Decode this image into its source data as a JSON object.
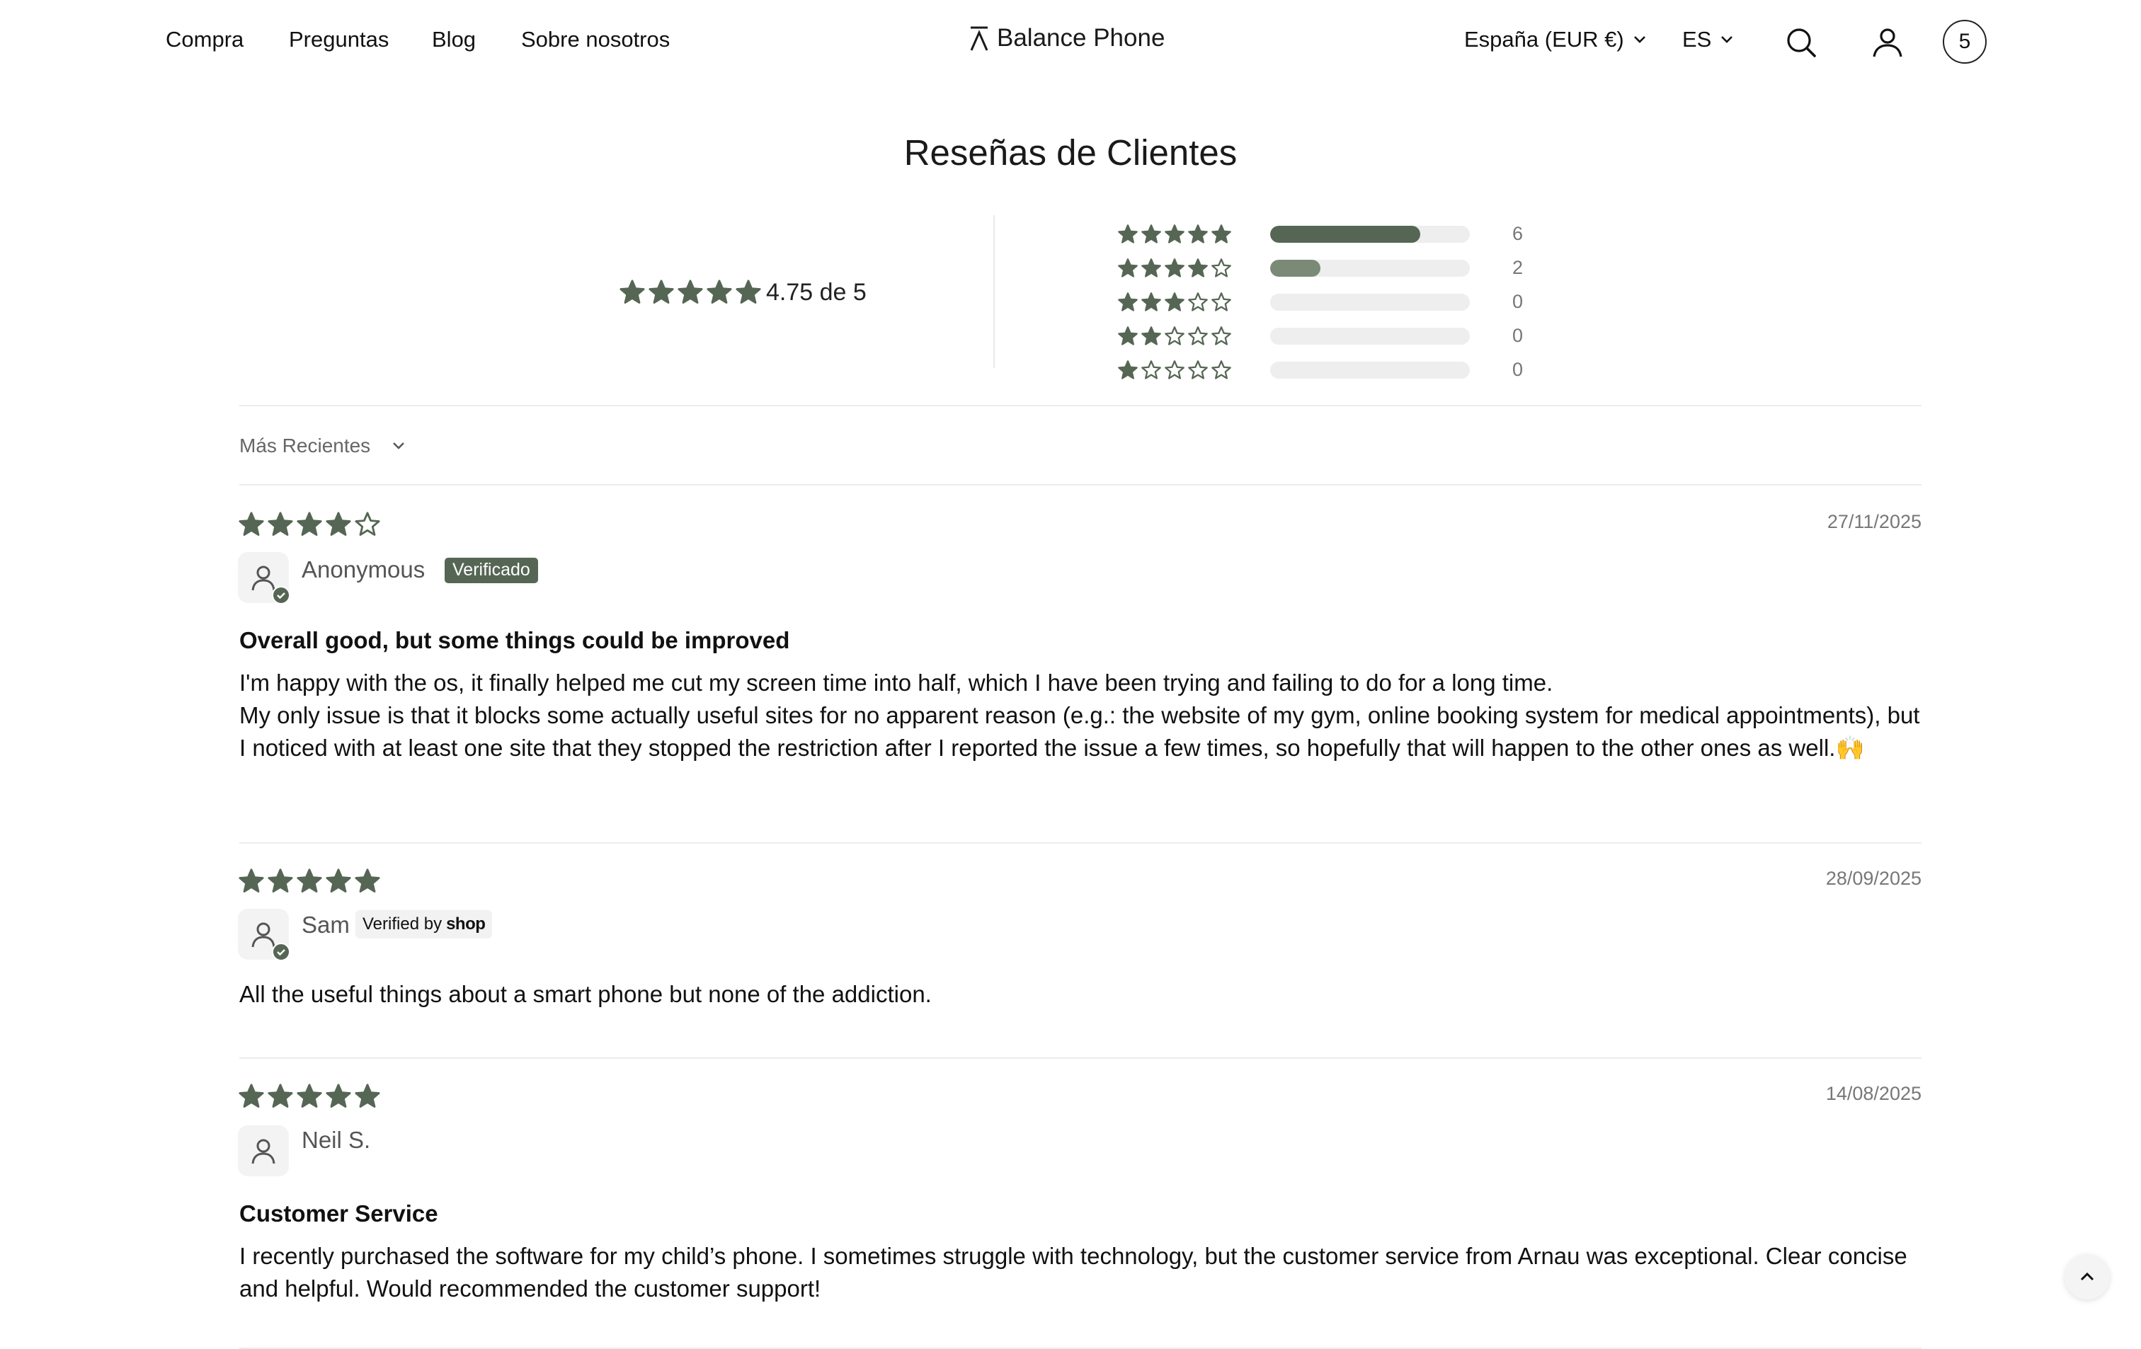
{
  "nav": {
    "links": [
      "Compra",
      "Preguntas",
      "Blog",
      "Sobre nosotros"
    ],
    "logo_text": "Balance Phone",
    "country_selector": "España (EUR €)",
    "language_selector": "ES",
    "cart_count": "5"
  },
  "reviews_summary": {
    "title": "Reseñas de Clientes",
    "average_rating": 4.75,
    "average_text": "4.75 de 5",
    "histogram": [
      {
        "stars": 5,
        "count": "6",
        "fraction": 0.75
      },
      {
        "stars": 4,
        "count": "2",
        "fraction": 0.25
      },
      {
        "stars": 3,
        "count": "0",
        "fraction": 0
      },
      {
        "stars": 2,
        "count": "0",
        "fraction": 0
      },
      {
        "stars": 1,
        "count": "0",
        "fraction": 0
      }
    ]
  },
  "sort": {
    "label": "Más Recientes"
  },
  "reviews": [
    {
      "rating": 4,
      "date": "27/11/2025",
      "name": "Anonymous",
      "badge": "Verificado",
      "title": "Overall good, but some things could be improved",
      "body": "I'm happy with the os, it finally helped me cut my screen time into half, which I have been trying and failing to do for a long time.\nMy only issue is that it blocks some actually useful sites for no apparent reason (e.g.: the website of my gym, online booking system for medical appointments), but I noticed with at least one site that they stopped the restriction after I reported the issue a few times, so hopefully that will happen to the other ones as well.🙌"
    },
    {
      "rating": 5,
      "date": "28/09/2025",
      "name": "Sam",
      "badge_prefix": "Verified by",
      "badge_brand": "shop",
      "body": "All the useful things about a smart phone but none of the addiction."
    },
    {
      "rating": 5,
      "date": "14/08/2025",
      "name": "Neil S.",
      "title": "Customer Service",
      "body": "I recently purchased the software for my child’s phone. I sometimes struggle with technology, but the customer service from Arnau was exceptional. Clear concise and helpful. Would recommended the customer support!"
    }
  ],
  "colors": {
    "star": "#566654",
    "bar_fill_5": "#566654",
    "bar_fill_4": "#7a8a77",
    "bar_track": "#eeeeee",
    "badge_bg": "#566654"
  },
  "icons": [
    "search-icon",
    "account-icon",
    "chevron-down-icon",
    "user-avatar-icon",
    "check-icon",
    "chevron-up-icon",
    "star-icon"
  ]
}
